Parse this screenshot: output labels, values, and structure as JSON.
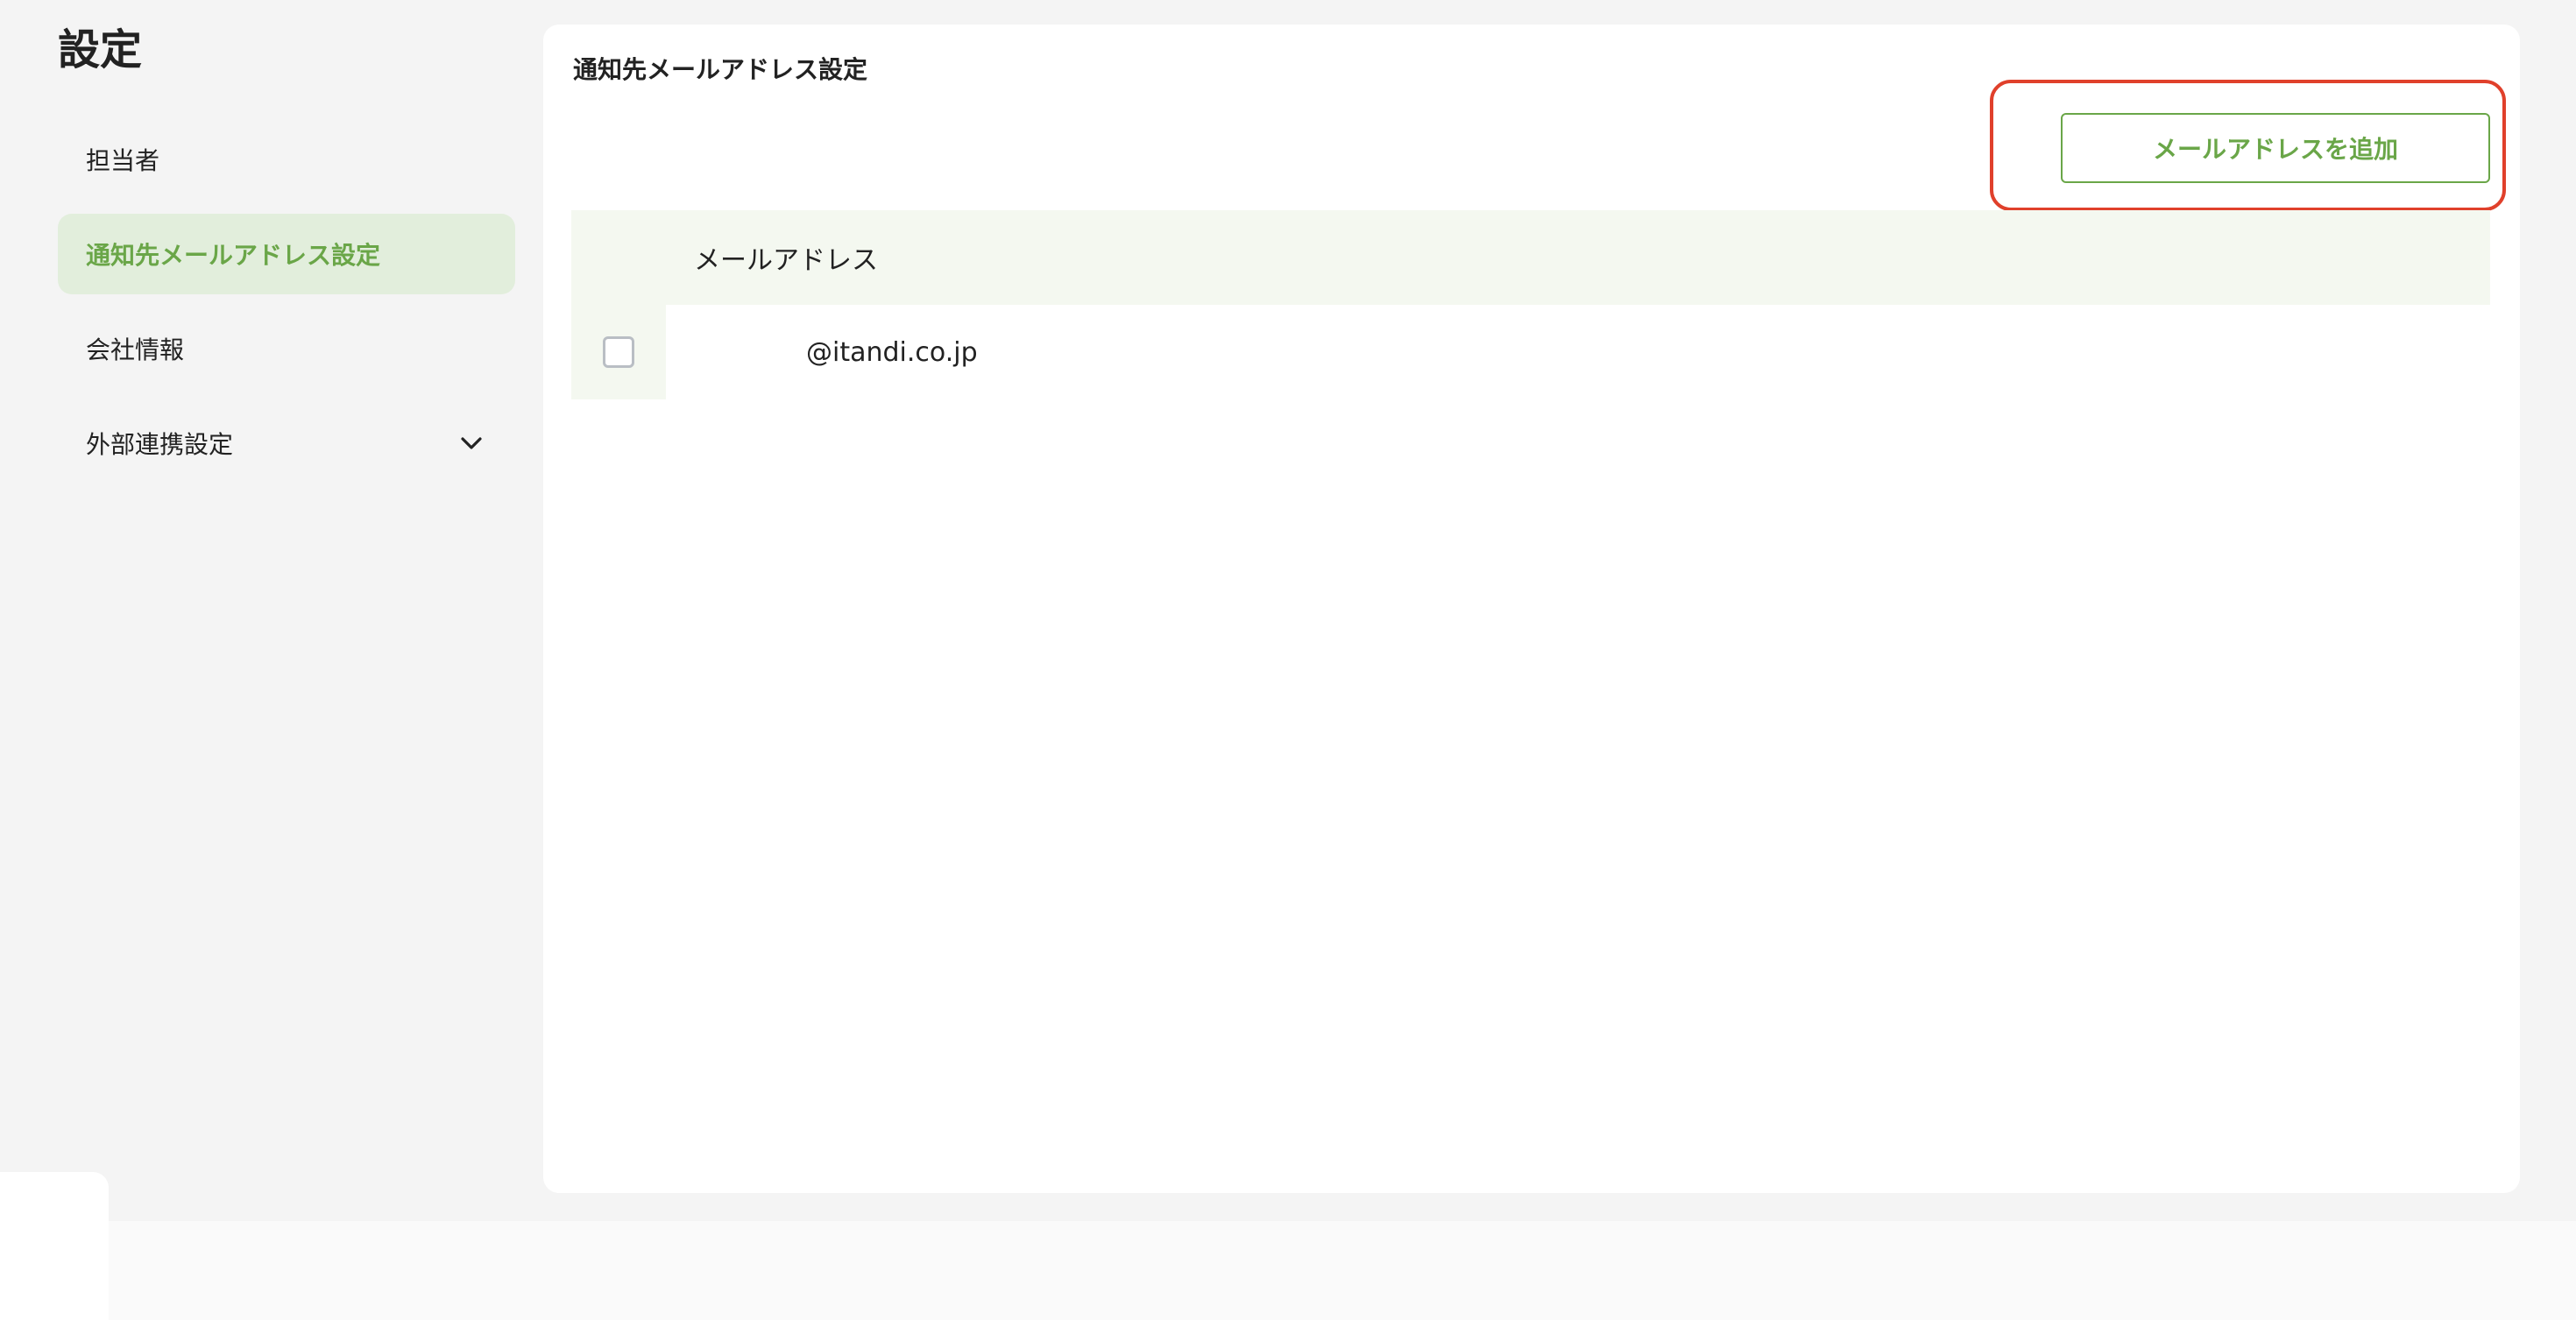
{
  "page": {
    "title": "設定"
  },
  "sidebar": {
    "items": [
      {
        "label": "担当者",
        "active": false
      },
      {
        "label": "通知先メールアドレス設定",
        "active": true
      },
      {
        "label": "会社情報",
        "active": false
      },
      {
        "label": "外部連携設定",
        "active": false,
        "icon": "chevron-down-icon"
      }
    ]
  },
  "main": {
    "title": "通知先メールアドレス設定",
    "add_button_label": "メールアドレスを追加",
    "table": {
      "columns": [
        "メールアドレス"
      ],
      "rows": [
        {
          "email": "@itandi.co.jp",
          "checked": false
        }
      ]
    }
  },
  "colors": {
    "accent": "#6aa648",
    "active_bg": "#e2eedc",
    "highlight": "#e0402b",
    "table_header_bg": "#f4f8f0"
  }
}
